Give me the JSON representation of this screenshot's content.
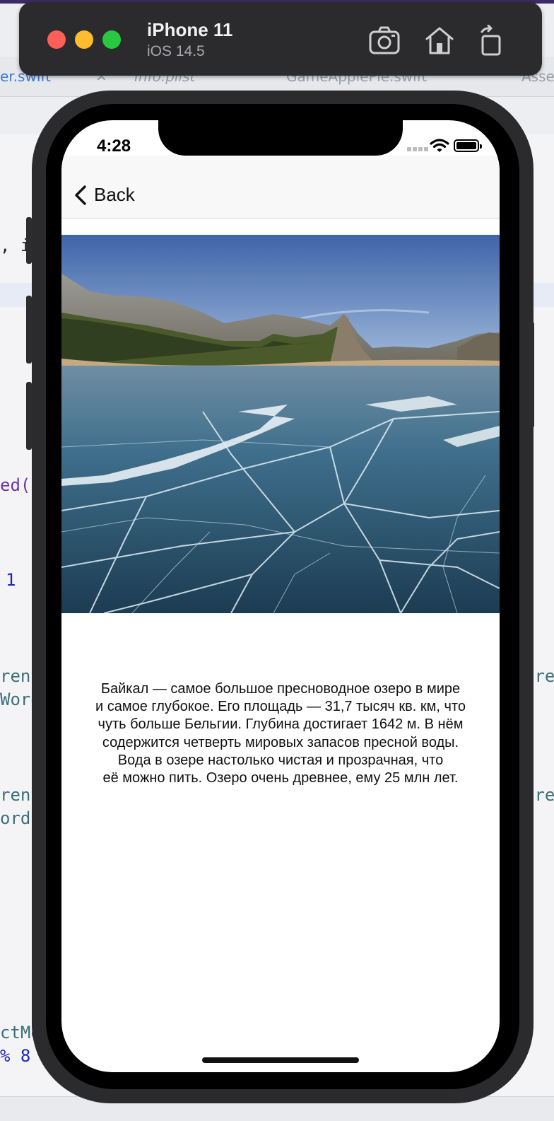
{
  "xcode": {
    "tabs": [
      "er.swift",
      "Info.plist",
      "GameApplePie.swift",
      "Asse"
    ],
    "code_fragments": [
      ", i",
      "ed(s",
      "1 ",
      "rent",
      "Word",
      "rent",
      "ord",
      "ctMo",
      "% 8",
      "ore",
      "ore"
    ]
  },
  "simulator": {
    "device_name": "iPhone 11",
    "os_version": "iOS 14.5",
    "icons": [
      "screenshot-icon",
      "home-icon",
      "rotate-icon"
    ]
  },
  "status_bar": {
    "time": "4:28"
  },
  "navbar": {
    "back_label": "Back"
  },
  "content": {
    "image_alt": "Frozen Lake Baikal with cracked blue ice",
    "description": "Байкал — самое большое пресноводное озеро в мире\nи самое глубокое. Его площадь — 31,7 тысяч кв. км, что\nчуть больше Бельгии. Глубина достигает 1642 м. В нём\nсодержится четверть мировых запасов пресной воды.\nВода в озере настолько чистая и прозрачная, что\nеё можно пить. Озеро очень древнее, ему 25 млн лет."
  },
  "colors": {
    "close": "#ff5f57",
    "minimize": "#febc2e",
    "zoom": "#28c840",
    "sky": "#5b7fb6",
    "ice": "#2c5a78"
  }
}
